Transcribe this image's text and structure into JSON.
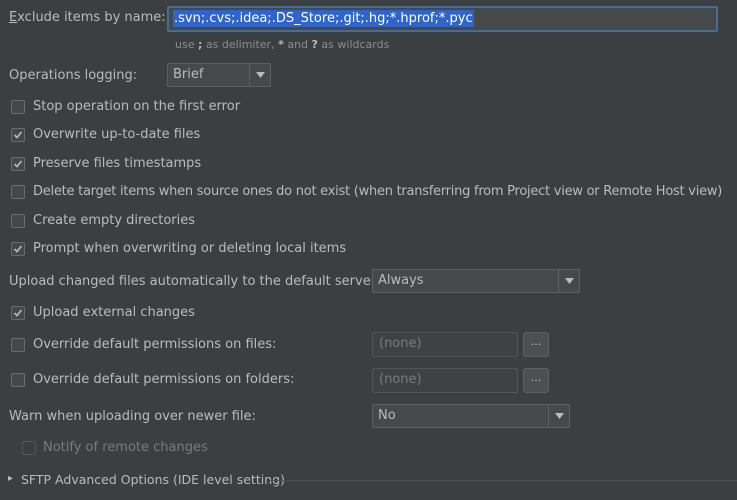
{
  "exclude": {
    "label_first": "E",
    "label_rest": "xclude items by name:",
    "value": ".svn;.cvs;.idea;.DS_Store;.git;.hg;*.hprof;*.pyc",
    "hint_a": "use ",
    "hint_b": ";",
    "hint_c": " as delimiter, ",
    "hint_d": "*",
    "hint_e": " and ",
    "hint_f": "?",
    "hint_g": " as wildcards"
  },
  "operations_logging": {
    "label": "Operations logging:",
    "value": "Brief"
  },
  "checkboxes": [
    {
      "label": "Stop operation on the first error",
      "checked": false
    },
    {
      "label": "Overwrite up-to-date files",
      "checked": true
    },
    {
      "label": "Preserve files timestamps",
      "checked": true
    },
    {
      "label": "Delete target items when source ones do not exist (when transferring from Project view or Remote Host view)",
      "checked": false
    },
    {
      "label": "Create empty directories",
      "checked": false
    },
    {
      "label": "Prompt when overwriting or deleting local items",
      "checked": true
    }
  ],
  "upload_auto": {
    "label": "Upload changed files automatically to the default server",
    "value": "Always"
  },
  "upload_external": {
    "label": "Upload external changes",
    "checked": true
  },
  "perm_files": {
    "label": "Override default permissions on files:",
    "value": "(none)",
    "button": "···"
  },
  "perm_folders": {
    "label": "Override default permissions on folders:",
    "value": "(none)",
    "button": "···"
  },
  "warn": {
    "label": "Warn when uploading over newer file:",
    "value": "No"
  },
  "notify": {
    "label": "Notify of remote changes"
  },
  "sftp": {
    "label": "SFTP Advanced Options (IDE level setting)",
    "arrow": "▸"
  },
  "colors": {
    "background": "#3c3f41",
    "text": "#bbbbbb",
    "selection": "#2f65ca",
    "focus_border": "#466d94"
  }
}
